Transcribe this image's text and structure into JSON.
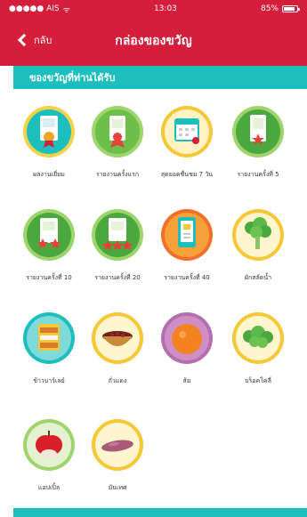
{
  "status_bar": {
    "carrier": "●●●●● AIS",
    "wifi": "ᯤ",
    "time": "13:03",
    "battery_text": "85%",
    "battery_level": 0.85
  },
  "nav": {
    "back_label": "กลับ",
    "title": "กล่องของขวัญ"
  },
  "section": {
    "title": "ของขวัญที่ท่านได้รับ"
  },
  "colors": {
    "header_red": "#d51d3c",
    "section_teal": "#1cbfbe"
  },
  "badges": [
    {
      "label": "ผลงานเยี่ยม",
      "icon": "certificate-medal-icon"
    },
    {
      "label": "รายงานครั้งแรก",
      "icon": "certificate-ribbon-icon"
    },
    {
      "label": "สุดยอดชื่นชม 7 วัน",
      "icon": "calendar-icon"
    },
    {
      "label": "รายงานครั้งที่ 5",
      "icon": "certificate-star-icon"
    },
    {
      "label": "รายงานครั้งที่ 10",
      "icon": "certificate-two-stars-icon"
    },
    {
      "label": "รายงานครั้งที่ 20",
      "icon": "certificate-three-stars-icon"
    },
    {
      "label": "รายงานครั้งที่ 40",
      "icon": "phone-certificate-icon"
    },
    {
      "label": "ผักสลัดน้ำ",
      "icon": "broccoli-icon"
    },
    {
      "label": "ข้าวบาร์เลย์",
      "icon": "cereal-box-icon"
    },
    {
      "label": "ถั่วแดง",
      "icon": "red-beans-bowl-icon"
    },
    {
      "label": "ส้ม",
      "icon": "orange-fruit-icon"
    },
    {
      "label": "บร็อคโคลี่",
      "icon": "broccoli-florets-icon"
    },
    {
      "label": "แอปเปิ้ล",
      "icon": "apple-icon"
    },
    {
      "label": "มันเทศ",
      "icon": "sweet-potato-icon"
    }
  ]
}
